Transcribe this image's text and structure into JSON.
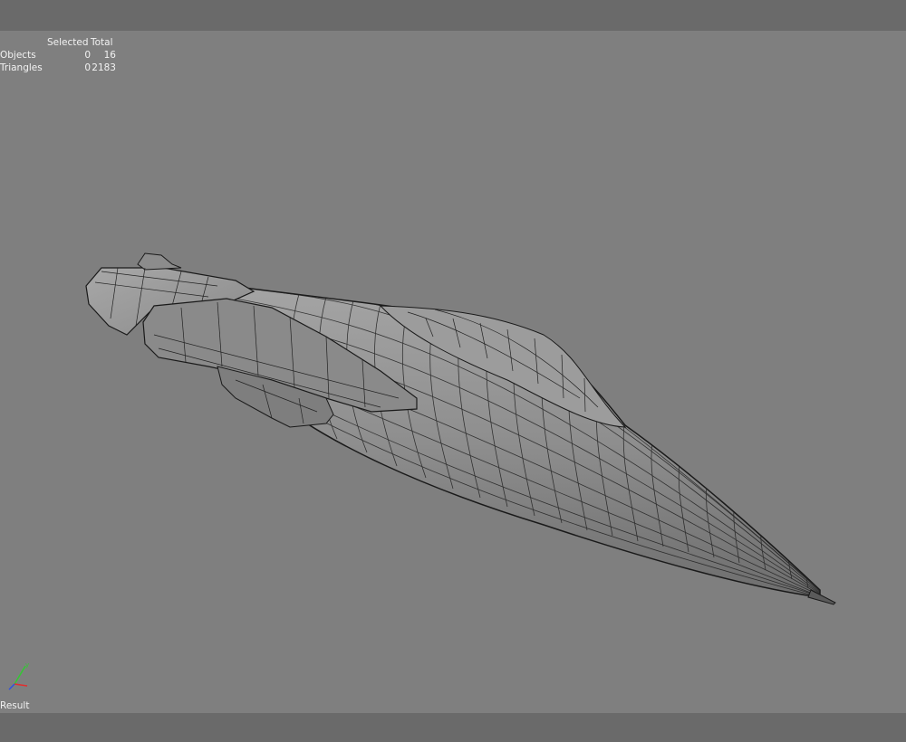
{
  "stats": {
    "header_selected": "Selected",
    "header_total": "Total",
    "rows": [
      {
        "label": "Objects",
        "selected": "0",
        "total": "16"
      },
      {
        "label": "Triangles",
        "selected": "0",
        "total": "2183"
      }
    ]
  },
  "viewport": {
    "label": "Result"
  },
  "colors": {
    "background": "#7f7f7f",
    "bars": "#6a6a6a",
    "mesh_fill": "#909090",
    "wire": "#1a1a1a"
  },
  "icons": {
    "axis_gizmo": "xyz-axis-icon"
  }
}
